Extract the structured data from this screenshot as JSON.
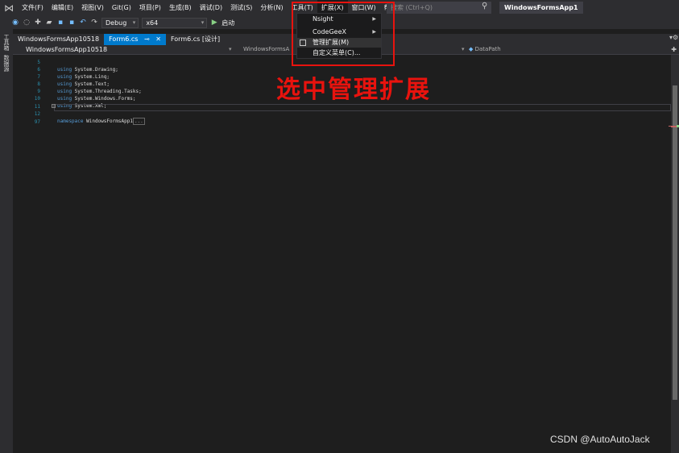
{
  "menubar": {
    "items": [
      "文件(F)",
      "编辑(E)",
      "视图(V)",
      "Git(G)",
      "项目(P)",
      "生成(B)",
      "调试(D)",
      "测试(S)",
      "分析(N)",
      "工具(T)",
      "扩展(X)",
      "窗口(W)",
      "帮助(H)"
    ],
    "search_placeholder": "搜索 (Ctrl+Q)",
    "app_title": "WindowsFormsApp1"
  },
  "toolbar": {
    "configuration": "Debug",
    "platform": "x64",
    "start_label": "启动"
  },
  "left_rail": {
    "toolbox": "工具箱",
    "data_sources": "数据源"
  },
  "tabs": [
    {
      "label": "WindowsFormsApp10518",
      "active": false
    },
    {
      "label": "Form6.cs",
      "active": true
    },
    {
      "label": "Form6.cs [设计]",
      "active": false
    }
  ],
  "navbar": {
    "project": "WindowsFormsApp10518",
    "scope": "WindowsFormsA",
    "member": "DataPath"
  },
  "code_lines": [
    {
      "num": "5",
      "kw": "using",
      "text": " System.Drawing;"
    },
    {
      "num": "6",
      "kw": "using",
      "text": " System.Linq;"
    },
    {
      "num": "7",
      "kw": "using",
      "text": " System.Text;"
    },
    {
      "num": "8",
      "kw": "using",
      "text": " System.Threading.Tasks;"
    },
    {
      "num": "9",
      "kw": "using",
      "text": " System.Windows.Forms;"
    },
    {
      "num": "10",
      "kw": "using",
      "text": " System.Xml;"
    },
    {
      "num": "11",
      "kw": "",
      "text": ""
    },
    {
      "num": "12",
      "kw": "namespace",
      "text": " WindowsFormsApp1"
    },
    {
      "num": "97",
      "kw": "",
      "text": ""
    }
  ],
  "ellipsis": "...",
  "extensions_menu": {
    "items": [
      "Nsight",
      "CodeGeeX",
      "管理扩展(M)",
      "自定义菜单(C)..."
    ]
  },
  "annotation": "选中管理扩展",
  "watermark": "CSDN @AutoAutoJack",
  "colors": {
    "annotation_red": "#e8130e",
    "accent_blue": "#007acc"
  }
}
